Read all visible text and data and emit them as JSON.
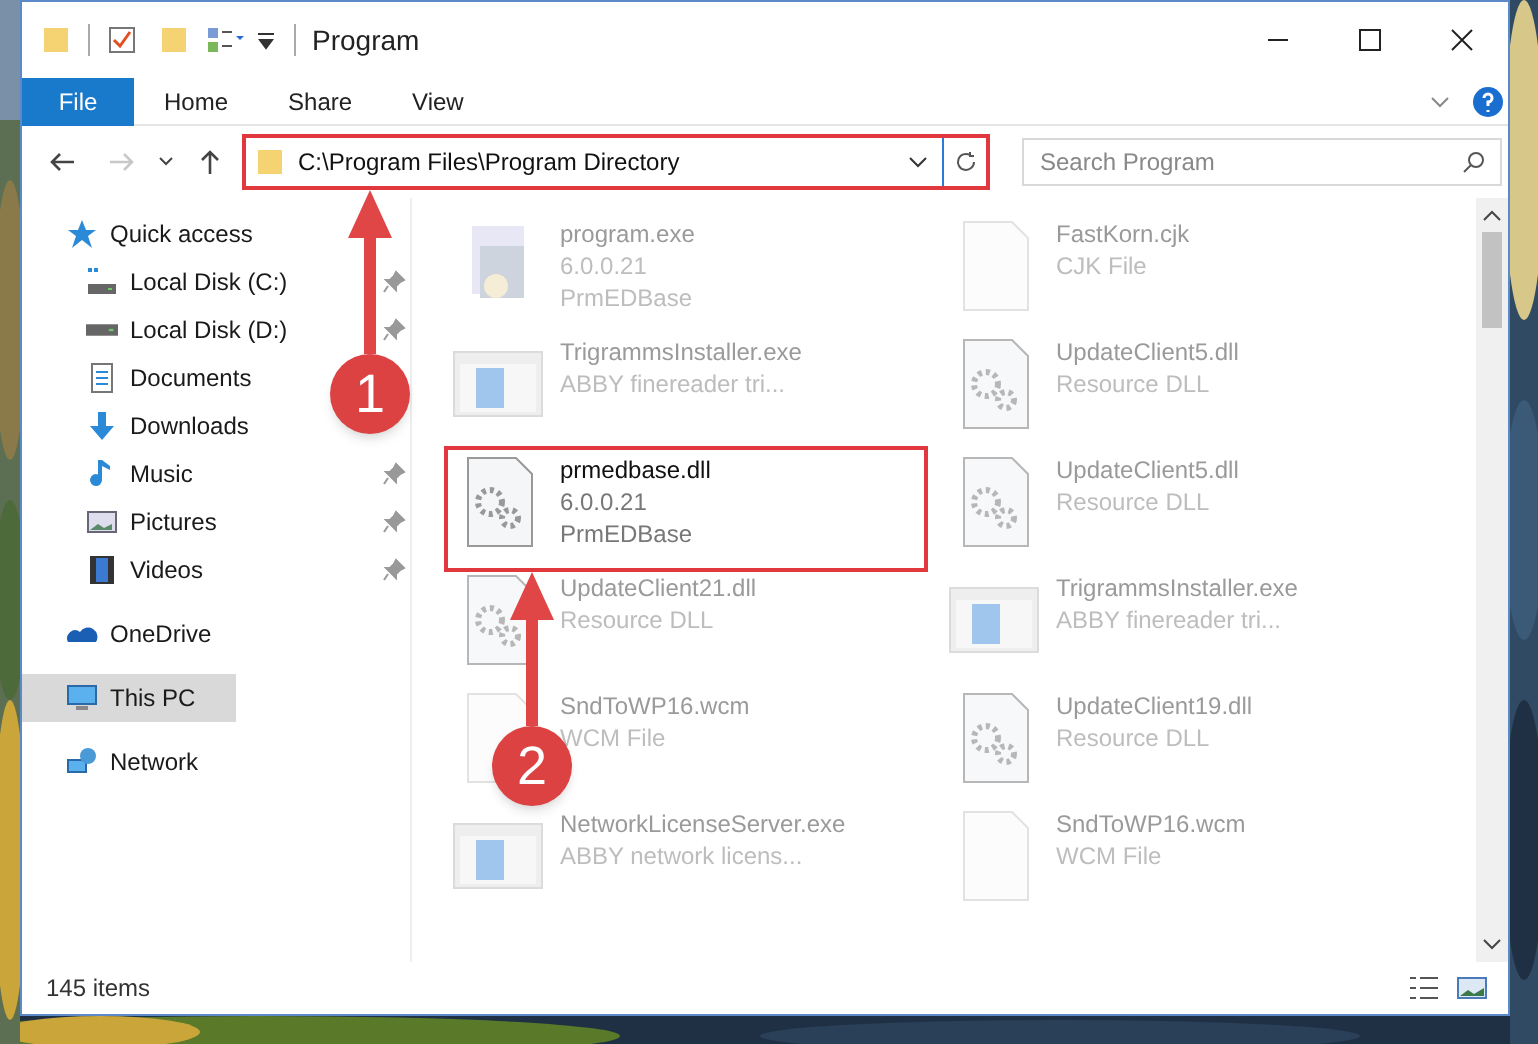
{
  "window": {
    "title": "Program"
  },
  "ribbon_tabs": [
    {
      "label": "File",
      "selected": true
    },
    {
      "label": "Home",
      "selected": false
    },
    {
      "label": "Share",
      "selected": false
    },
    {
      "label": "View",
      "selected": false
    }
  ],
  "navigation": {
    "forward_disabled": true
  },
  "address_bar": {
    "path": "C:\\Program Files\\Program Directory",
    "highlighted": true
  },
  "search": {
    "placeholder": "Search Program"
  },
  "sidebar": {
    "items": [
      {
        "label": "Quick access",
        "kind": "star",
        "selected": false,
        "children": [
          {
            "label": "Local Disk (C:)",
            "kind": "system-drive",
            "pinned": true,
            "selected": false
          },
          {
            "label": "Local Disk (D:)",
            "kind": "drive",
            "pinned": true,
            "selected": false
          },
          {
            "label": "Documents",
            "kind": "documents",
            "selected": false
          },
          {
            "label": "Downloads",
            "kind": "downloads",
            "selected": false
          },
          {
            "label": "Music",
            "kind": "music",
            "pinned": true,
            "selected": false
          },
          {
            "label": "Pictures",
            "kind": "pictures",
            "pinned": true,
            "selected": false
          },
          {
            "label": "Videos",
            "kind": "videos",
            "pinned": true,
            "selected": false
          }
        ]
      },
      {
        "label": "OneDrive",
        "kind": "cloud",
        "selected": false
      },
      {
        "label": "This PC",
        "kind": "pc",
        "selected": true
      },
      {
        "label": "Network",
        "kind": "network",
        "selected": false
      }
    ]
  },
  "files": [
    {
      "name": "program.exe",
      "lines": [
        "6.0.0.21",
        "PrmEDBase"
      ],
      "kind": "app",
      "highlighted": false
    },
    {
      "name": "FastKorn.cjk",
      "lines": [
        "CJK File"
      ],
      "kind": "blank",
      "highlighted": false
    },
    {
      "name": "TrigrammsInstaller.exe",
      "lines": [
        "ABBY finereader tri..."
      ],
      "kind": "window",
      "highlighted": false
    },
    {
      "name": "UpdateClient5.dll",
      "lines": [
        "Resource DLL"
      ],
      "kind": "dll",
      "highlighted": false
    },
    {
      "name": "prmedbase.dll",
      "lines": [
        "6.0.0.21",
        "PrmEDBase"
      ],
      "kind": "dll",
      "highlighted": true
    },
    {
      "name": "UpdateClient5.dll",
      "lines": [
        "Resource DLL"
      ],
      "kind": "dll",
      "highlighted": false
    },
    {
      "name": "UpdateClient21.dll",
      "lines": [
        "Resource DLL"
      ],
      "kind": "dll",
      "highlighted": false
    },
    {
      "name": "TrigrammsInstaller.exe",
      "lines": [
        "ABBY finereader tri..."
      ],
      "kind": "window",
      "highlighted": false
    },
    {
      "name": "SndToWP16.wcm",
      "lines": [
        "WCM File"
      ],
      "kind": "blank",
      "highlighted": false
    },
    {
      "name": "UpdateClient19.dll",
      "lines": [
        "Resource DLL"
      ],
      "kind": "dll",
      "highlighted": false
    },
    {
      "name": "NetworkLicenseServer.exe",
      "lines": [
        "ABBY network licens..."
      ],
      "kind": "window",
      "highlighted": false
    },
    {
      "name": "SndToWP16.wcm",
      "lines": [
        "WCM File"
      ],
      "kind": "blank",
      "highlighted": false
    }
  ],
  "status_bar": {
    "item_count": "145 items"
  },
  "annotations": [
    {
      "label": "1"
    },
    {
      "label": "2"
    }
  ]
}
